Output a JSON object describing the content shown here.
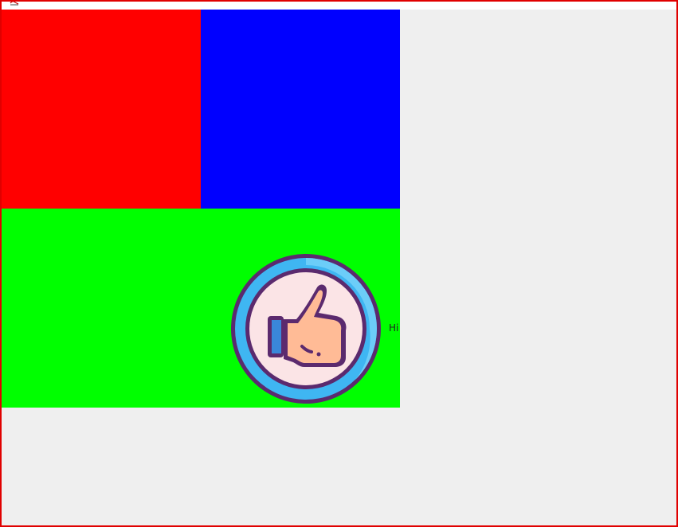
{
  "window": {
    "border_color": "#e00000",
    "background": "#efefef",
    "titlebar_icon": "app-icon"
  },
  "panels": [
    {
      "name": "red-panel",
      "color": "#ff0000"
    },
    {
      "name": "blue-panel",
      "color": "#0000ff"
    },
    {
      "name": "green-panel",
      "color": "#00ff00"
    }
  ],
  "like_button": {
    "icon": "thumbs-up-icon",
    "label": "Hi"
  }
}
